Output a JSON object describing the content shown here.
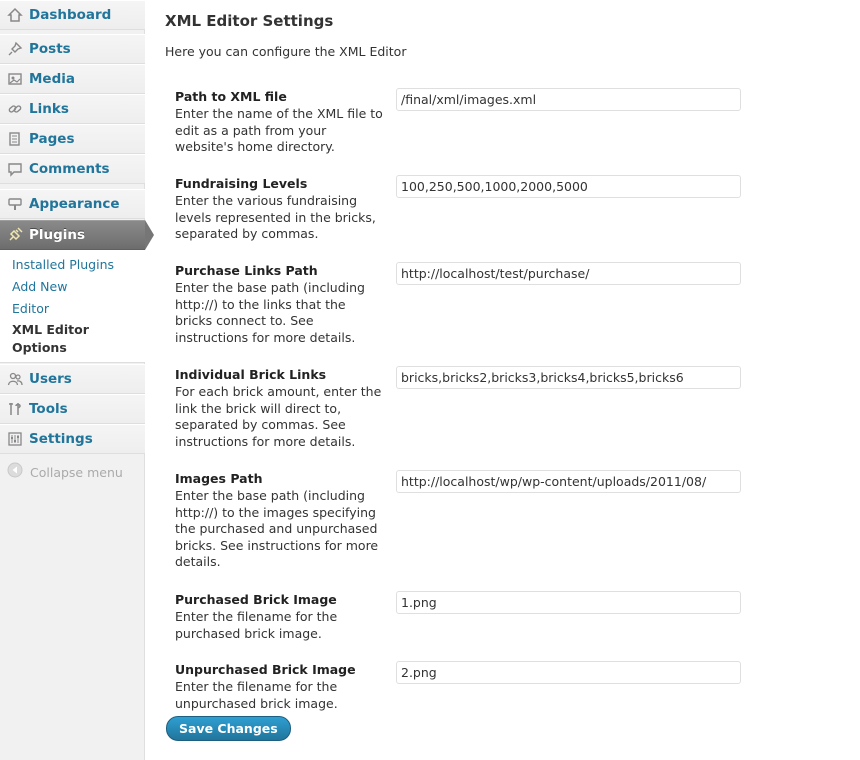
{
  "sidebar": {
    "items": [
      {
        "label": "Dashboard",
        "icon": "dashboard-icon"
      },
      {
        "label": "Posts",
        "icon": "pin-icon"
      },
      {
        "label": "Media",
        "icon": "media-icon"
      },
      {
        "label": "Links",
        "icon": "link-icon"
      },
      {
        "label": "Pages",
        "icon": "pages-icon"
      },
      {
        "label": "Comments",
        "icon": "comment-icon"
      },
      {
        "label": "Appearance",
        "icon": "appearance-icon"
      },
      {
        "label": "Plugins",
        "icon": "plugin-icon"
      },
      {
        "label": "Users",
        "icon": "users-icon"
      },
      {
        "label": "Tools",
        "icon": "tools-icon"
      },
      {
        "label": "Settings",
        "icon": "settings-icon"
      }
    ],
    "submenu": [
      "Installed Plugins",
      "Add New",
      "Editor",
      "XML Editor Options"
    ],
    "collapse_label": "Collapse menu"
  },
  "main": {
    "title": "XML Editor Settings",
    "intro": "Here you can configure the XML Editor",
    "fields": [
      {
        "label": "Path to XML file",
        "description": "Enter the name of the XML file to edit as a path from your website's home directory.",
        "value": "/final/xml/images.xml"
      },
      {
        "label": "Fundraising Levels",
        "description": "Enter the various fundraising levels represented in the bricks, separated by commas.",
        "value": "100,250,500,1000,2000,5000"
      },
      {
        "label": "Purchase Links Path",
        "description": "Enter the base path (including http://) to the links that the bricks connect to. See instructions for more details.",
        "value": "http://localhost/test/purchase/"
      },
      {
        "label": "Individual Brick Links",
        "description": "For each brick amount, enter the link the brick will direct to, separated by commas. See instructions for more details.",
        "value": "bricks,bricks2,bricks3,bricks4,bricks5,bricks6"
      },
      {
        "label": "Images Path",
        "description": "Enter the base path (including http://) to the images specifying the purchased and unpurchased bricks. See instructions for more details.",
        "value": "http://localhost/wp/wp-content/uploads/2011/08/"
      },
      {
        "label": "Purchased Brick Image",
        "description": "Enter the filename for the purchased brick image.",
        "value": "1.png"
      },
      {
        "label": "Unpurchased Brick Image",
        "description": "Enter the filename for the unpurchased brick image.",
        "value": "2.png"
      }
    ],
    "save_label": "Save Changes"
  },
  "colors": {
    "link": "#21759b",
    "active_menu": "#767676",
    "button": "#21759b"
  }
}
